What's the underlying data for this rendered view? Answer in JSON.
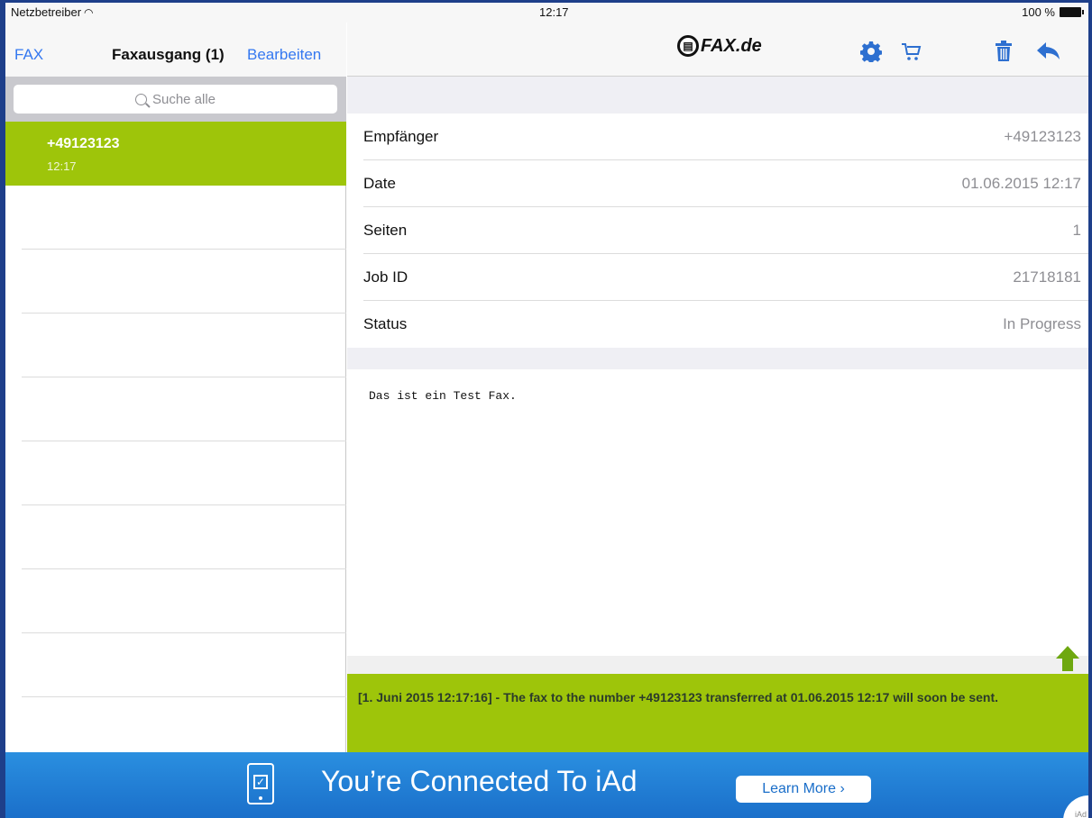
{
  "status_bar": {
    "carrier": "Netzbetreiber",
    "clock": "12:17",
    "battery": "100 %"
  },
  "left_nav": {
    "back_label": "FAX",
    "title": "Faxausgang (1)",
    "edit_label": "Bearbeiten"
  },
  "search": {
    "placeholder": "Suche alle"
  },
  "fax_list": [
    {
      "number": "+49123123",
      "time": "12:17",
      "selected": true
    }
  ],
  "right_nav": {
    "logo_text": "FAX.de",
    "icons": [
      "gear-icon",
      "cart-icon",
      "trash-icon",
      "reply-icon"
    ],
    "icon_color": "#2d6fd0"
  },
  "details": [
    {
      "label": "Empfänger",
      "value": "+49123123"
    },
    {
      "label": "Date",
      "value": "01.06.2015 12:17"
    },
    {
      "label": "Seiten",
      "value": "1"
    },
    {
      "label": "Job ID",
      "value": "21718181"
    },
    {
      "label": "Status",
      "value": "In Progress"
    }
  ],
  "message": {
    "body": "Das ist ein Test Fax."
  },
  "log": {
    "text": "[1. Juni 2015 12:17:16] - The fax to the number +49123123 transferred at 01.06.2015 12:17 will soon be sent."
  },
  "ad": {
    "headline": "You’re Connected To iAd",
    "button_label": "Learn More ›",
    "corner_label": "iAd"
  },
  "colors": {
    "accent_green": "#9ec50a",
    "link_blue": "#3478f0",
    "ad_blue": "#1a6ec9",
    "frame_blue": "#1e3f8a"
  }
}
